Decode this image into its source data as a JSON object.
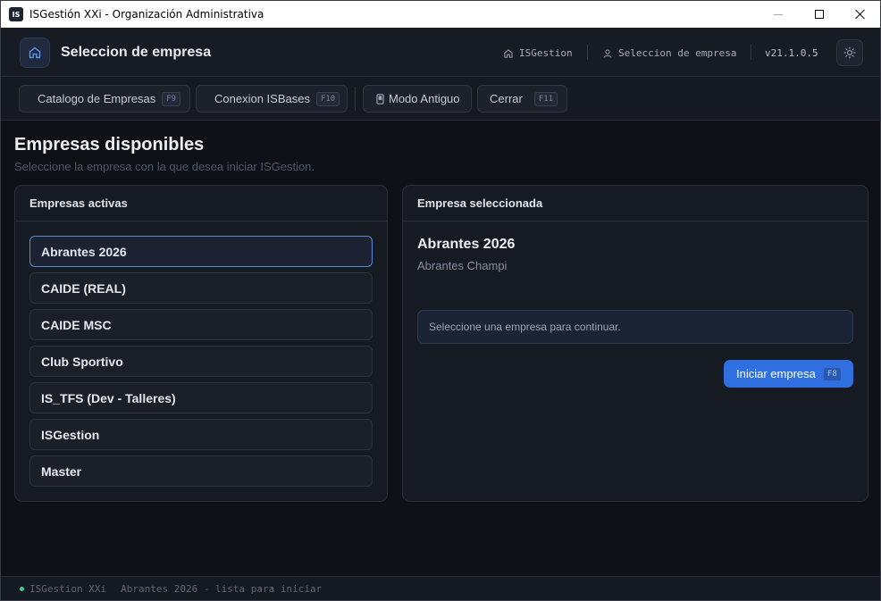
{
  "window": {
    "app_icon_text": "IS",
    "title": "ISGestión XXi - Organización Administrativa"
  },
  "header": {
    "title": "Seleccion de empresa",
    "crumb_home": "ISGestion",
    "crumb_current": "Seleccion de empresa",
    "version": "v21.1.0.5"
  },
  "toolbar": {
    "buttons": [
      {
        "label": "Catalogo de Empresas",
        "key": "F9"
      },
      {
        "label": "Conexion ISBases",
        "key": "F10"
      },
      {
        "label": "Modo Antiguo",
        "key": ""
      },
      {
        "label": "Cerrar",
        "key": "F11"
      }
    ]
  },
  "main": {
    "title": "Empresas disponibles",
    "subtitle": "Seleccione la empresa con la que desea iniciar ISGestion."
  },
  "companies_panel": {
    "title": "Empresas activas",
    "items": [
      "Abrantes 2026",
      "CAIDE (REAL)",
      "CAIDE MSC",
      "Club Sportivo",
      "IS_TFS (Dev - Talleres)",
      "ISGestion",
      "Master"
    ],
    "selected_index": 0
  },
  "selected_panel": {
    "title": "Empresa seleccionada",
    "name": "Abrantes 2026",
    "description": "Abrantes Champi",
    "notice": "Seleccione una empresa para continuar.",
    "start_label": "Iniciar empresa",
    "start_key": "F8"
  },
  "status": {
    "app": "ISGestion XXi",
    "message": "Abrantes 2026 - lista para iniciar"
  },
  "colors": {
    "accent": "#2f6fe0",
    "background": "#0f1117",
    "status_ok": "#3ecf8e"
  }
}
